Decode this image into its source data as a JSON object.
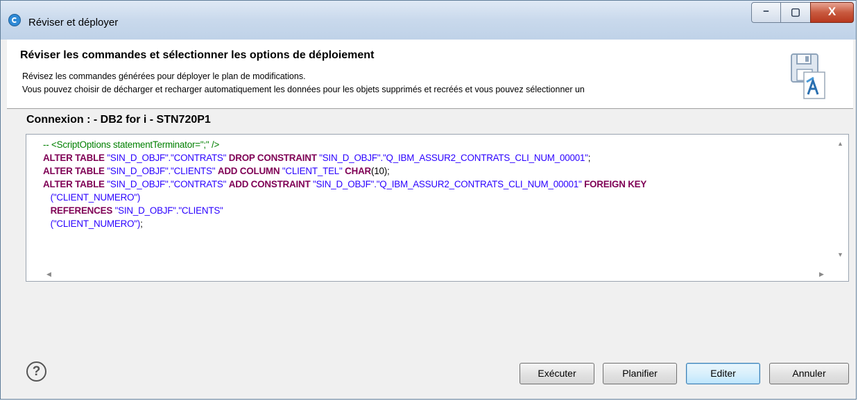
{
  "window": {
    "title": "Réviser et déployer",
    "controls": {
      "minimize": "−",
      "maximize": "▢",
      "close": "X"
    }
  },
  "header": {
    "title": "Réviser les commandes et sélectionner les options de déploiement",
    "description_line1": "Révisez les commandes générées pour déployer le plan de modifications.",
    "description_line2": "Vous pouvez choisir de décharger et recharger automatiquement les données pour les objets supprimés et recréés et vous pouvez sélectionner un"
  },
  "connection": {
    "label": "Connexion : - DB2 for i - STN720P1"
  },
  "script": {
    "line1_comment": "-- <ScriptOptions statementTerminator=\";\" />",
    "line2": {
      "kw1": "ALTER TABLE",
      "s1": " \"SIN_D_OBJF\".\"CONTRATS\" ",
      "kw2": "DROP CONSTRAINT",
      "s2": " \"SIN_D_OBJF\".\"Q_IBM_ASSUR2_CONTRATS_CLI_NUM_00001\"",
      "p": ";"
    },
    "line3": {
      "kw1": "ALTER TABLE",
      "s1": " \"SIN_D_OBJF\".\"CLIENTS\" ",
      "kw2": "ADD COLUMN",
      "s2": " \"CLIENT_TEL\" ",
      "kw3": "CHAR",
      "p": "(10);"
    },
    "line4": {
      "kw1": "ALTER TABLE",
      "s1": " \"SIN_D_OBJF\".\"CONTRATS\" ",
      "kw2": "ADD CONSTRAINT",
      "s2": " \"SIN_D_OBJF\".\"Q_IBM_ASSUR2_CONTRATS_CLI_NUM_00001\" ",
      "kw3": "FOREIGN KEY"
    },
    "line5": {
      "s": "(\"CLIENT_NUMERO\")"
    },
    "line6": {
      "kw": "REFERENCES",
      "s": " \"SIN_D_OBJF\".\"CLIENTS\""
    },
    "line7": {
      "s": "(\"CLIENT_NUMERO\")",
      "p": ";"
    }
  },
  "footer": {
    "help_glyph": "?",
    "buttons": {
      "execute": "Exécuter",
      "schedule": "Planifier",
      "edit": "Editer",
      "cancel": "Annuler"
    }
  }
}
